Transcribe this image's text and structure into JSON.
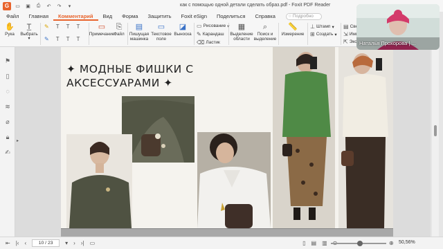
{
  "title_bar": {
    "document_title": "как с помощью одной детали сделать образ.pdf - Foxit PDF Reader",
    "logo_letter": "G",
    "quick_icons": [
      "open-icon",
      "save-icon",
      "print-icon",
      "undo-icon",
      "redo-icon"
    ]
  },
  "menu": {
    "items": [
      "Файл",
      "Главная",
      "Комментарий",
      "Вид",
      "Форма",
      "Защитить",
      "Foxit eSign",
      "Поделиться",
      "Справка"
    ],
    "active": "Комментарий",
    "search_placeholder": "Подробно"
  },
  "ribbon": {
    "hand_label": "Рука",
    "select_label": "Выбрать",
    "note_label": "Примечание",
    "file_label": "Файл",
    "typewriter_label": "Пишущая машинка",
    "textfield_label": "Текстовое поле",
    "callout_label": "Выноска",
    "drawing_label": "Рисование",
    "pencil_label": "Карандаш",
    "eraser_label": "Ластик",
    "area_highlight_label": "Выделение области",
    "search_highlight_label": "Поиск и выделение",
    "measure_label": "Измерение",
    "stamp_label": "Штамп",
    "create_label": "Создать",
    "partial_labels": [
      "Свес",
      "Импо",
      "Экспо"
    ]
  },
  "slide": {
    "title_line1": "✦ МОДНЫЕ ФИШКИ С",
    "title_line2": "АКСЕССУАРАМИ ✦"
  },
  "video": {
    "participant_name": "Наталья Прохорова | ..."
  },
  "status": {
    "page_indicator": "10 / 23",
    "zoom": "50,56%"
  }
}
